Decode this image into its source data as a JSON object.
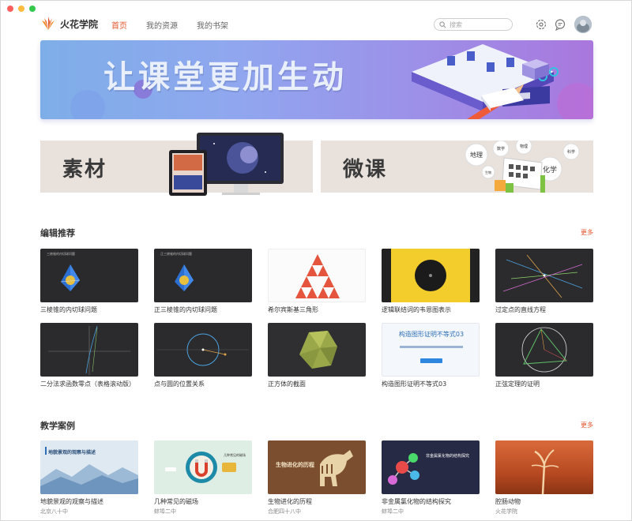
{
  "app": {
    "name": "火花学院"
  },
  "nav": [
    {
      "label": "首页",
      "active": true
    },
    {
      "label": "我的资源",
      "active": false
    },
    {
      "label": "我的书架",
      "active": false
    }
  ],
  "search": {
    "placeholder": "搜索"
  },
  "banner": {
    "title": "让课堂更加生动"
  },
  "categories": [
    {
      "label": "素材"
    },
    {
      "label": "微课",
      "bubbles": [
        "地理",
        "数学",
        "物理",
        "化学",
        "科学",
        "生物"
      ]
    }
  ],
  "editor_picks": {
    "title": "编辑推荐",
    "more": "更多",
    "items": [
      {
        "title": "三棱锥的内切球问题",
        "thumb_text": "三棱锥的内切球问题"
      },
      {
        "title": "正三棱锥的内切球问题",
        "thumb_text": "正三棱锥的内切球问题"
      },
      {
        "title": "希尔宾斯基三角形"
      },
      {
        "title": "逻辑联结词的韦恩图表示"
      },
      {
        "title": "过定点的直线方程"
      },
      {
        "title": "二分法求函数零点（表格滚动版）"
      },
      {
        "title": "点与圆的位置关系"
      },
      {
        "title": "正方体的截面"
      },
      {
        "title": "构造图形证明不等式03",
        "thumb_text": "构造图形证明不等式03"
      },
      {
        "title": "正弦定理的证明"
      }
    ]
  },
  "cases": {
    "title": "教学案例",
    "more": "更多",
    "items": [
      {
        "title": "地貌景观的观察与描述",
        "school": "北京八十中",
        "thumb_text": "地貌景观的观察与描述"
      },
      {
        "title": "几种常见的磁场",
        "school": "蚌埠二中",
        "thumb_text": "几种常见的磁场"
      },
      {
        "title": "生物进化的历程",
        "school": "合肥四十八中",
        "thumb_text": "生物进化的历程"
      },
      {
        "title": "非金属氯化物的结构探究",
        "school": "蚌埠二中",
        "thumb_text": "非金属氯化物的结构探究"
      },
      {
        "title": "腔肠动物",
        "school": "火花学院"
      }
    ]
  },
  "colors": {
    "accent": "#e2552d"
  }
}
